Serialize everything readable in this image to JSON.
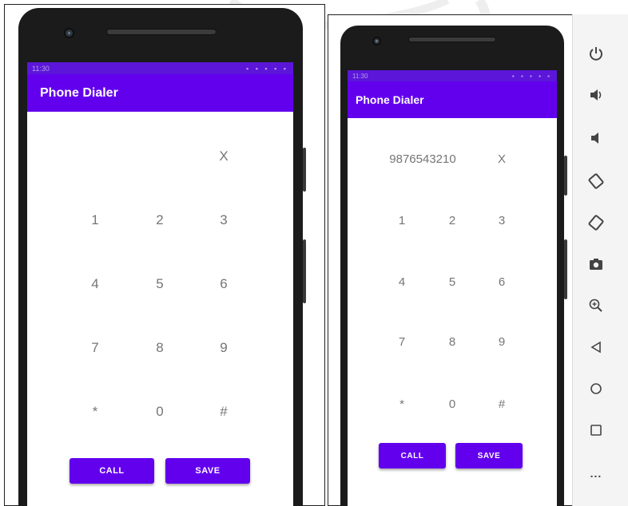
{
  "colors": {
    "app_bar": "#6200ee",
    "status_bar": "#5b16d9",
    "button": "#6200ee",
    "key_text": "#757575",
    "device": "#1b1b1b"
  },
  "left_screen": {
    "status_time": "11:30",
    "title": "Phone Dialer",
    "display_value": "",
    "clear_label": "X",
    "keys": [
      [
        "1",
        "2",
        "3"
      ],
      [
        "4",
        "5",
        "6"
      ],
      [
        "7",
        "8",
        "9"
      ],
      [
        "*",
        "0",
        "#"
      ]
    ],
    "call_label": "CALL",
    "save_label": "SAVE"
  },
  "right_screen": {
    "status_time": "11:30",
    "title": "Phone Dialer",
    "display_value": "9876543210",
    "clear_label": "X",
    "keys": [
      [
        "1",
        "2",
        "3"
      ],
      [
        "4",
        "5",
        "6"
      ],
      [
        "7",
        "8",
        "9"
      ],
      [
        "*",
        "0",
        "#"
      ]
    ],
    "call_label": "CALL",
    "save_label": "SAVE"
  },
  "emulator_toolbar": {
    "icons": [
      "power-icon",
      "volume-up-icon",
      "volume-down-icon",
      "rotate-left-icon",
      "rotate-right-icon",
      "camera-icon",
      "zoom-in-icon",
      "back-icon",
      "home-icon",
      "overview-icon",
      "more-icon"
    ],
    "more_label": "..."
  }
}
